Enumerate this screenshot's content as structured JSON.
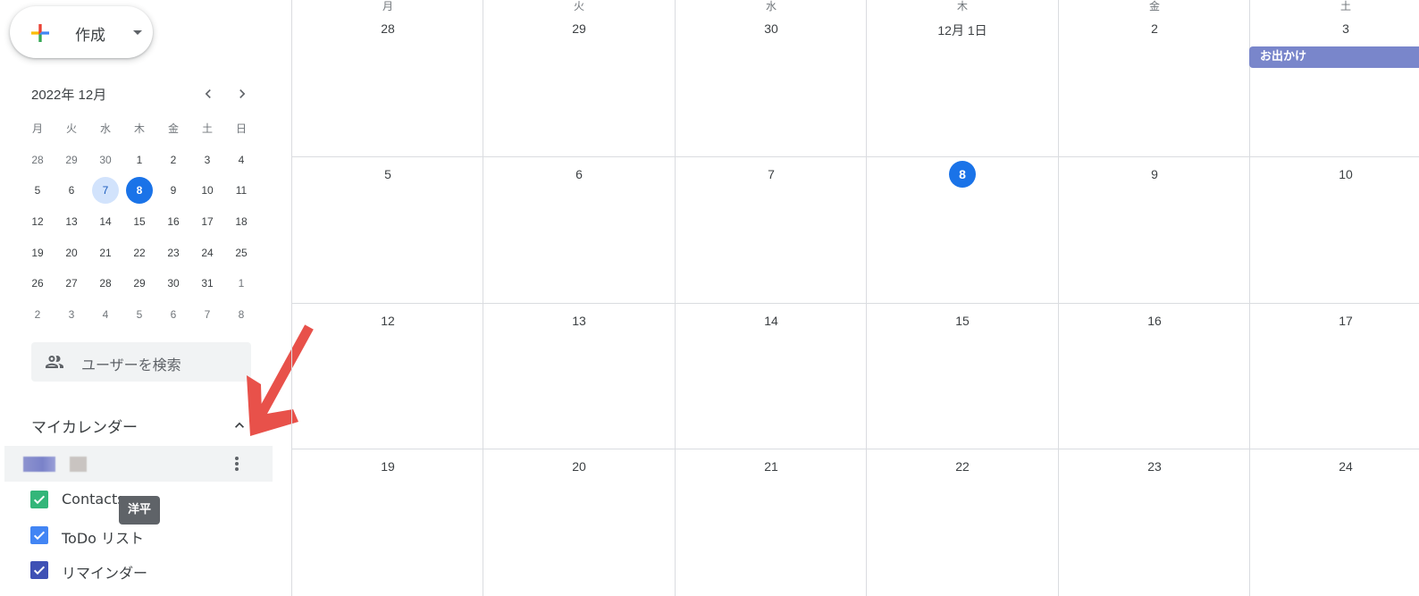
{
  "create": {
    "label": "作成"
  },
  "mini_calendar": {
    "title": "2022年 12月",
    "weekdays": [
      "月",
      "火",
      "水",
      "木",
      "金",
      "土",
      "日"
    ],
    "weeks": [
      [
        "28",
        "29",
        "30",
        "1",
        "2",
        "3",
        "4"
      ],
      [
        "5",
        "6",
        "7",
        "8",
        "9",
        "10",
        "11"
      ],
      [
        "12",
        "13",
        "14",
        "15",
        "16",
        "17",
        "18"
      ],
      [
        "19",
        "20",
        "21",
        "22",
        "23",
        "24",
        "25"
      ],
      [
        "26",
        "27",
        "28",
        "29",
        "30",
        "31",
        "1"
      ],
      [
        "2",
        "3",
        "4",
        "5",
        "6",
        "7",
        "8"
      ]
    ]
  },
  "search_people": {
    "placeholder": "ユーザーを検索"
  },
  "my_calendars": {
    "title": "マイカレンダー",
    "items": [
      {
        "name": "Contacts",
        "color": "#33b679"
      },
      {
        "name": "ToDo リスト",
        "color": "#4285f4"
      },
      {
        "name": "リマインダー",
        "color": "#3f51b5"
      }
    ]
  },
  "tooltip": {
    "text": "洋平"
  },
  "month_view": {
    "weekdays": [
      "月",
      "火",
      "水",
      "木",
      "金",
      "土"
    ],
    "weeks": [
      [
        "28",
        "29",
        "30",
        "12月 1日",
        "2",
        "3"
      ],
      [
        "5",
        "6",
        "7",
        "8",
        "9",
        "10"
      ],
      [
        "12",
        "13",
        "14",
        "15",
        "16",
        "17"
      ],
      [
        "19",
        "20",
        "21",
        "22",
        "23",
        "24"
      ]
    ],
    "today": "8",
    "event": {
      "title": "お出かけ",
      "color": "#7986cb"
    }
  },
  "colors": {
    "accent": "#1a73e8",
    "annotation_arrow": "#e8514a"
  }
}
